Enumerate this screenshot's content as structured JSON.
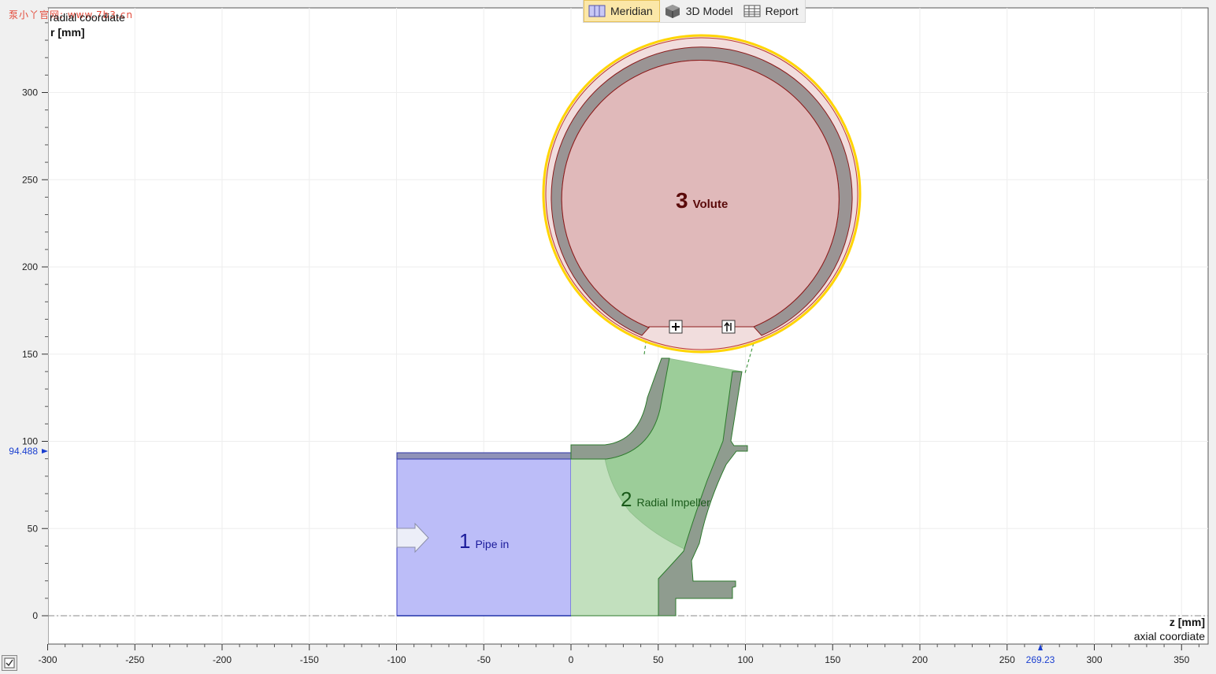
{
  "watermark": "泵小丫官网: www.7b3.cn",
  "toolbar": {
    "items": [
      {
        "label": "Meridian",
        "icon": "meridian-icon",
        "active": true
      },
      {
        "label": "3D Model",
        "icon": "cube-icon",
        "active": false
      },
      {
        "label": "Report",
        "icon": "table-icon",
        "active": false
      }
    ]
  },
  "axes": {
    "y_title": "radial coordiate",
    "y_unit": "r [mm]",
    "x_unit": "z [mm]",
    "x_title": "axial coordiate",
    "x_ticks": [
      "-300",
      "-250",
      "-200",
      "-150",
      "-100",
      "-50",
      "0",
      "50",
      "100",
      "150",
      "200",
      "250",
      "300",
      "350"
    ],
    "x_tick_values": [
      -300,
      -250,
      -200,
      -150,
      -100,
      -50,
      0,
      50,
      100,
      150,
      200,
      250,
      300,
      350
    ],
    "y_ticks": [
      "0",
      "50",
      "100",
      "150",
      "200",
      "250",
      "300"
    ],
    "y_tick_values": [
      0,
      50,
      100,
      150,
      200,
      250,
      300
    ],
    "x_marker": "269.23",
    "y_marker": "94.488"
  },
  "components": [
    {
      "number": "1",
      "name": "Pipe in",
      "color": "#b8b8f7"
    },
    {
      "number": "2",
      "name": "Radial Impeller",
      "color": "#9fcf9a"
    },
    {
      "number": "3",
      "name": "Volute",
      "color": "#e0b9ba"
    }
  ],
  "colors": {
    "plot_bg": "#ffffff",
    "grid": "#e8e8e8",
    "marker_blue": "#1a3fd0",
    "volute_outline": "#ffd500"
  }
}
